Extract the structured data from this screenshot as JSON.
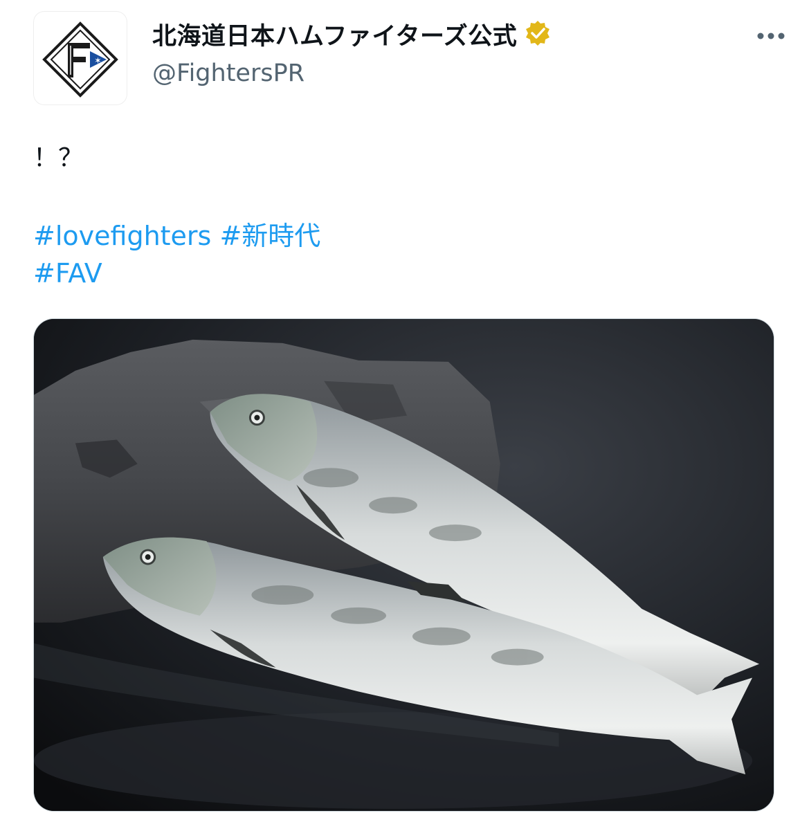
{
  "author": {
    "display_name": "北海道日本ハムファイターズ公式",
    "handle": "@FightersPR",
    "verified": true,
    "verified_badge_color": "#e2b719",
    "avatar_letter": "F"
  },
  "tweet": {
    "text": "！？",
    "hashtags_line1": [
      "#lovefighters",
      "#新時代"
    ],
    "hashtags_line2": [
      "#FAV"
    ]
  },
  "media": {
    "kind": "photo",
    "subject": "two salmon on a dark rock"
  },
  "colors": {
    "link": "#1d9bf0",
    "text": "#0f1419",
    "secondary": "#536471"
  },
  "icons": {
    "more": "more-horizontal-icon",
    "verified": "verified-badge-icon"
  }
}
